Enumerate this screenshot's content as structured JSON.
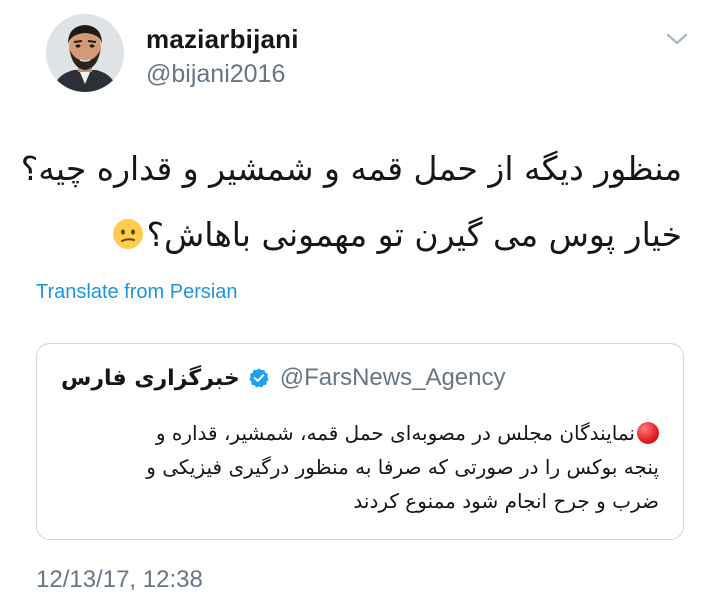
{
  "tweet": {
    "author_name": "maziarbijani",
    "author_handle": "@bijani2016",
    "text_lines": [
      "منظور دیگه از حمل قمه و شمشیر و قداره چیه؟",
      "خیار پوس می گیرن تو مهمونی باهاش؟"
    ],
    "emoji_icon": "confused-face-emoji",
    "translate_label": "Translate from Persian",
    "timestamp": "12/13/17, 12:38"
  },
  "quoted_tweet": {
    "author_name": "خبرگزاری فارس",
    "verified_icon": "verified-badge-icon",
    "author_handle": "@FarsNews_Agency",
    "bullet_icon": "red-circle-emoji",
    "text_lines": [
      "نمایندگان مجلس در مصوبه‌ای حمل قمه، شمشیر، قداره و",
      "پنجه بوکس را در صورتی که صرفا به منظور درگیری فیزیکی و",
      "ضرب و جرح انجام شود ممنوع کردند"
    ]
  },
  "colors": {
    "link_blue": "#1b95e0",
    "secondary_gray": "#657786",
    "border_gray": "#ccd6dd",
    "text_dark": "#14171a"
  }
}
